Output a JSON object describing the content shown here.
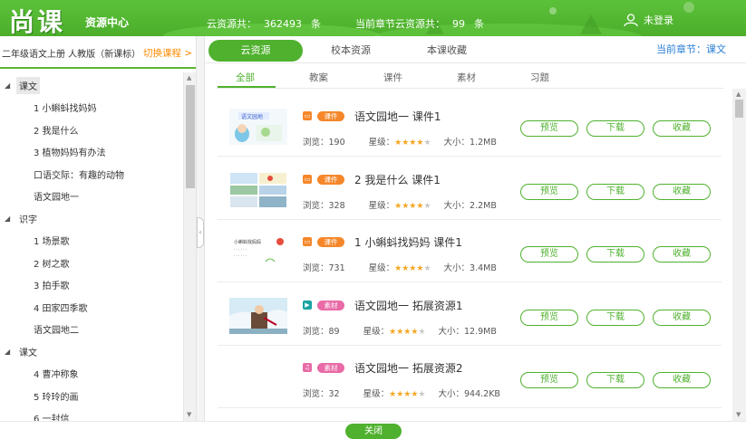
{
  "header": {
    "logo": "尚课",
    "resource_center": "资源中心",
    "cloud_total_label": "云资源共：",
    "cloud_total_count": "362493",
    "cloud_total_unit": "条",
    "chapter_total_label": "当前章节云资源共：",
    "chapter_total_count": "99",
    "chapter_total_unit": "条",
    "login_label": "未登录"
  },
  "course": {
    "name": "二年级语文上册 人教版（新课标）",
    "switch_label": "切换课程 >"
  },
  "tree": [
    {
      "label": "课文",
      "level": 0,
      "selected": true
    },
    {
      "label": "1 小蝌蚪找妈妈",
      "level": 1
    },
    {
      "label": "2 我是什么",
      "level": 1
    },
    {
      "label": "3 植物妈妈有办法",
      "level": 1
    },
    {
      "label": "口语交际：有趣的动物",
      "level": 1
    },
    {
      "label": "语文园地一",
      "level": 1
    },
    {
      "label": "识字",
      "level": 0
    },
    {
      "label": "1 场景歌",
      "level": 1
    },
    {
      "label": "2 树之歌",
      "level": 1
    },
    {
      "label": "3 拍手歌",
      "level": 1
    },
    {
      "label": "4 田家四季歌",
      "level": 1
    },
    {
      "label": "语文园地二",
      "level": 1
    },
    {
      "label": "课文",
      "level": 0
    },
    {
      "label": "4 曹冲称象",
      "level": 1
    },
    {
      "label": "5 玲玲的画",
      "level": 1
    },
    {
      "label": "6 一封信",
      "level": 1
    }
  ],
  "main_tabs": [
    "云资源",
    "校本资源",
    "本课收藏"
  ],
  "current_chapter": "当前章节：课文",
  "sub_tabs": [
    "全部",
    "教案",
    "课件",
    "素材",
    "习题"
  ],
  "labels": {
    "views": "浏览：",
    "rating": "星级：",
    "size": "大小：",
    "preview": "预览",
    "download": "下载",
    "favorite": "收藏",
    "close": "关闭"
  },
  "resources": [
    {
      "title": "语文园地一 课件1",
      "badge": "课件",
      "views": "190",
      "stars": 4,
      "size": "1.2MB",
      "badge_color": "#f5872a",
      "icon_color": "#f5872a"
    },
    {
      "title": "2 我是什么 课件1",
      "badge": "课件",
      "views": "328",
      "stars": 4,
      "size": "2.2MB",
      "badge_color": "#f5872a",
      "icon_color": "#f5872a"
    },
    {
      "title": "1 小蝌蚪找妈妈 课件1",
      "badge": "课件",
      "views": "731",
      "stars": 4,
      "size": "3.4MB",
      "badge_color": "#f5872a",
      "icon_color": "#f5872a"
    },
    {
      "title": "语文园地一 拓展资源1",
      "badge": "素材",
      "views": "89",
      "stars": 4,
      "size": "12.9MB",
      "badge_color": "#e86aa6",
      "icon_color": "#1aa3a3"
    },
    {
      "title": "语文园地一 拓展资源2",
      "badge": "素材",
      "views": "32",
      "stars": 4,
      "size": "944.2KB",
      "badge_color": "#e86aa6",
      "icon_color": "#e86aa6"
    }
  ]
}
